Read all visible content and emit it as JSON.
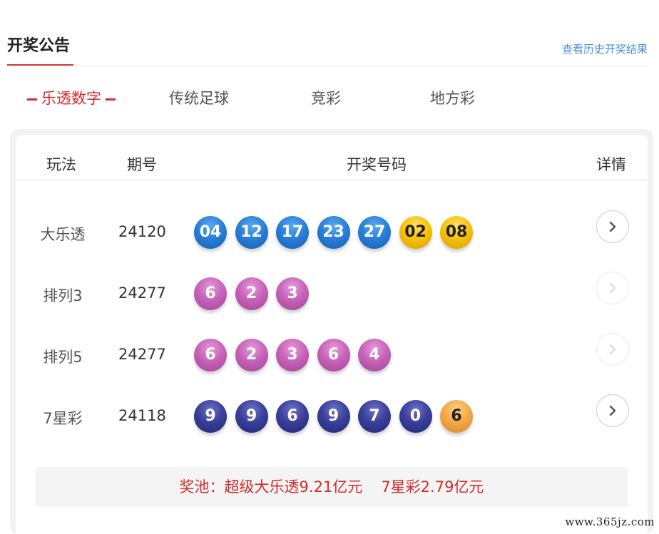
{
  "header": {
    "title": "开奖公告",
    "history_link": "查看历史开奖结果"
  },
  "tabs": [
    {
      "label": "乐透数字",
      "active": true
    },
    {
      "label": "传统足球",
      "active": false
    },
    {
      "label": "竞彩",
      "active": false
    },
    {
      "label": "地方彩",
      "active": false
    }
  ],
  "table": {
    "headers": {
      "game": "玩法",
      "issue": "期号",
      "numbers": "开奖号码",
      "detail": "详情"
    },
    "rows": [
      {
        "game": "大乐透",
        "issue": "24120",
        "balls": [
          "04",
          "12",
          "17",
          "23",
          "27",
          "02",
          "08"
        ],
        "colors": [
          "blue",
          "blue",
          "blue",
          "blue",
          "blue",
          "gold",
          "gold"
        ],
        "detail_enabled": true
      },
      {
        "game": "排列3",
        "issue": "24277",
        "balls": [
          "6",
          "2",
          "3"
        ],
        "colors": [
          "pink",
          "pink",
          "pink"
        ],
        "detail_enabled": false
      },
      {
        "game": "排列5",
        "issue": "24277",
        "balls": [
          "6",
          "2",
          "3",
          "6",
          "4"
        ],
        "colors": [
          "pink",
          "pink",
          "pink",
          "pink",
          "pink"
        ],
        "detail_enabled": false
      },
      {
        "game": "7星彩",
        "issue": "24118",
        "balls": [
          "9",
          "9",
          "6",
          "9",
          "7",
          "0",
          "6"
        ],
        "colors": [
          "navy",
          "navy",
          "navy",
          "navy",
          "navy",
          "navy",
          "orange"
        ],
        "detail_enabled": true
      }
    ]
  },
  "jackpot": {
    "item1": "奖池：超级大乐透9.21亿元",
    "item2": "7星彩2.79亿元"
  },
  "watermark": "www.365jz.com",
  "colors": {
    "accent_red": "#d62b2b",
    "link_blue": "#4a8fd9"
  }
}
